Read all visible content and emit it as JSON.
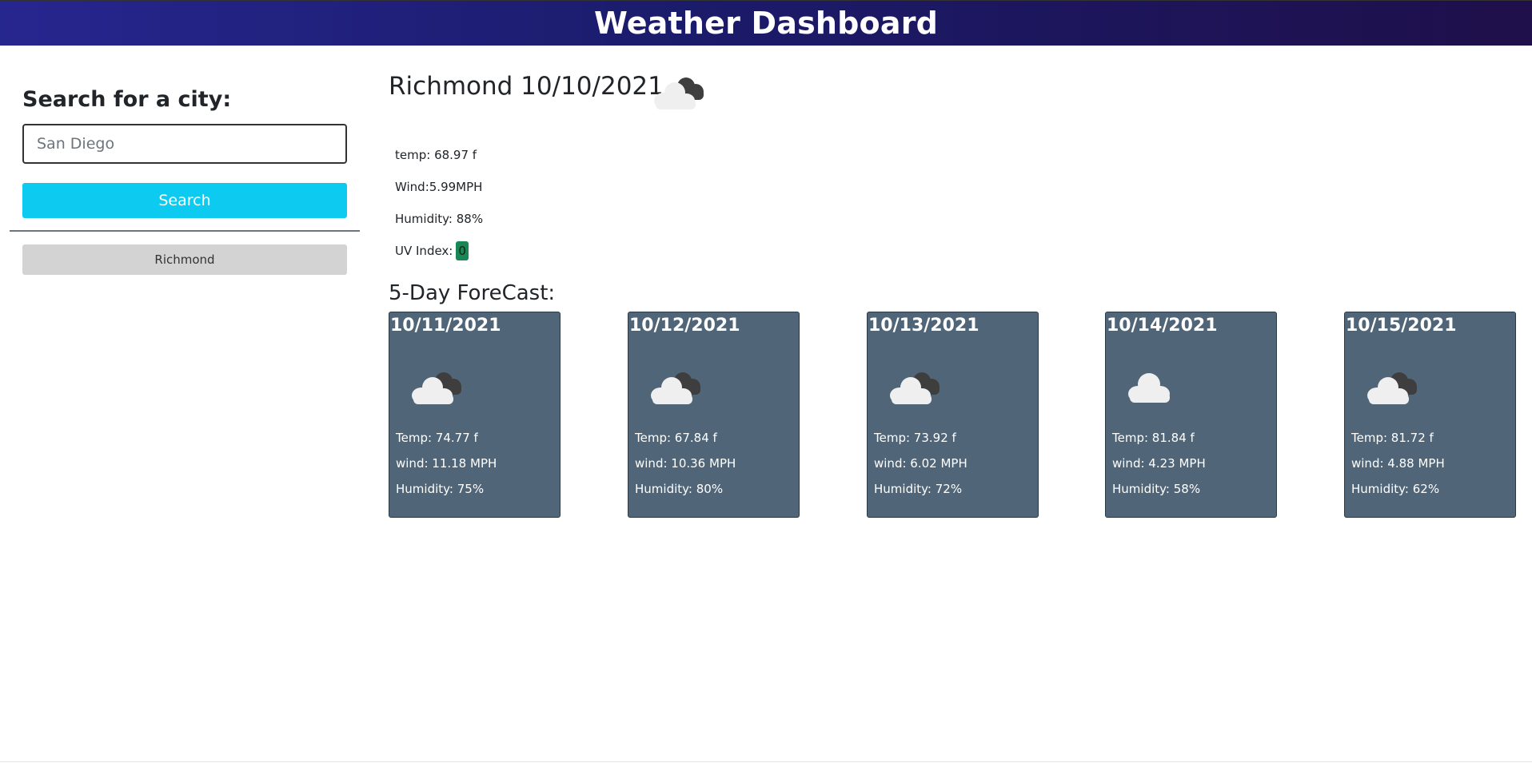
{
  "header": {
    "title": "Weather Dashboard"
  },
  "sidebar": {
    "heading": "Search for a city:",
    "search_placeholder": "San Diego",
    "search_button": "Search",
    "history": [
      "Richmond"
    ]
  },
  "current": {
    "title": "Richmond 10/10/2021",
    "icon": "broken-clouds-icon",
    "temp": "temp: 68.97 f",
    "wind": "Wind:5.99MPH",
    "humidity": "Humidity: 88%",
    "uv_label": "UV Index:",
    "uv_value": "0",
    "uv_color": "#198754"
  },
  "forecast": {
    "heading": "5-Day ForeCast:",
    "card_color": "#506578",
    "days": [
      {
        "date": "10/11/2021",
        "icon": "broken-clouds-icon",
        "temp": "Temp: 74.77 f",
        "wind": "wind: 11.18 MPH",
        "humidity": "Humidity: 75%"
      },
      {
        "date": "10/12/2021",
        "icon": "broken-clouds-icon",
        "temp": "Temp: 67.84 f",
        "wind": "wind: 10.36 MPH",
        "humidity": "Humidity: 80%"
      },
      {
        "date": "10/13/2021",
        "icon": "broken-clouds-icon",
        "temp": "Temp: 73.92 f",
        "wind": "wind: 6.02 MPH",
        "humidity": "Humidity: 72%"
      },
      {
        "date": "10/14/2021",
        "icon": "cloud-icon",
        "temp": "Temp: 81.84 f",
        "wind": "wind: 4.23 MPH",
        "humidity": "Humidity: 58%"
      },
      {
        "date": "10/15/2021",
        "icon": "broken-clouds-icon",
        "temp": "Temp: 81.72 f",
        "wind": "wind: 4.88 MPH",
        "humidity": "Humidity: 62%"
      }
    ]
  },
  "colors": {
    "header_start": "#26268f",
    "header_end": "#1f0f4a",
    "search_button": "#0dcaf0",
    "history_button": "#d3d3d3"
  }
}
